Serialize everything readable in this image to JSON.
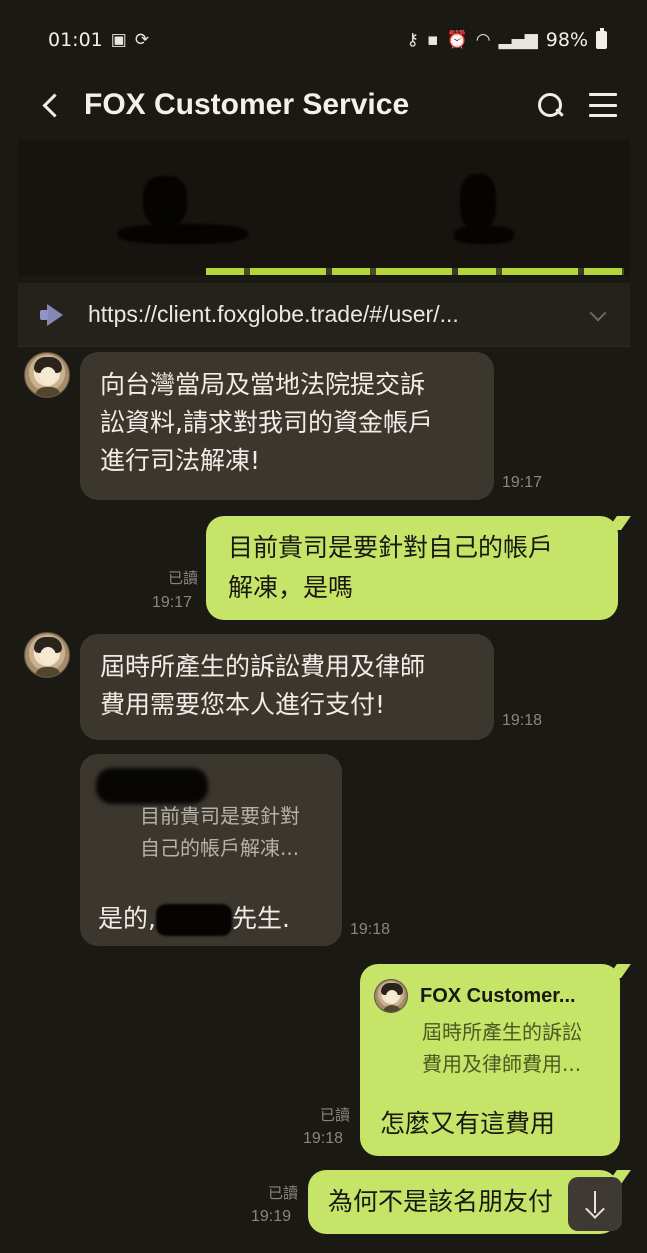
{
  "status_bar": {
    "time": "01:01",
    "battery": "98%",
    "left_icons": [
      "gallery-icon",
      "sync-icon"
    ],
    "right_icons": [
      "key-icon",
      "lock-icon",
      "alarm-icon",
      "wifi-icon",
      "volte-icon",
      "signal-icon",
      "battery-icon"
    ]
  },
  "header": {
    "title": "FOX Customer Service"
  },
  "announcement": {
    "text": "https://client.foxglobe.trade/#/user/..."
  },
  "colors": {
    "background": "#1b1914",
    "incoming_bubble": "#3b372f",
    "outgoing_bubble": "#c6e468",
    "banner_green": "#b5d63a"
  },
  "messages": [
    {
      "direction": "in",
      "text": "向台灣當局及當地法院提交訴訟資料,請求對我司的資金帳戶進行司法解凍!",
      "lines": [
        "向台灣當局及當地法院提交訴",
        "訟資料,請求對我司的資金帳戶",
        "進行司法解凍!"
      ],
      "time": "19:17"
    },
    {
      "direction": "out",
      "lines": [
        "目前貴司是要針對自己的帳戶",
        "解凍，是嗎"
      ],
      "read": "已讀",
      "time": "19:17"
    },
    {
      "direction": "in",
      "lines": [
        "屆時所產生的訴訟費用及律師",
        "費用需要您本人進行支付!"
      ],
      "time": "19:18"
    },
    {
      "direction": "in",
      "quote_lines": [
        "目前貴司是要針對",
        "自己的帳戶解凍..."
      ],
      "reply_prefix": "是的,",
      "reply_suffix": "先生.",
      "time": "19:18"
    },
    {
      "direction": "out",
      "quote_name": "FOX Customer...",
      "quote_lines": [
        "屆時所產生的訴訟",
        "費用及律師費用..."
      ],
      "text": "怎麼又有這費用",
      "read": "已讀",
      "time": "19:18"
    },
    {
      "direction": "out",
      "text": "為何不是該名朋友付",
      "read": "已讀",
      "time": "19:19"
    }
  ]
}
